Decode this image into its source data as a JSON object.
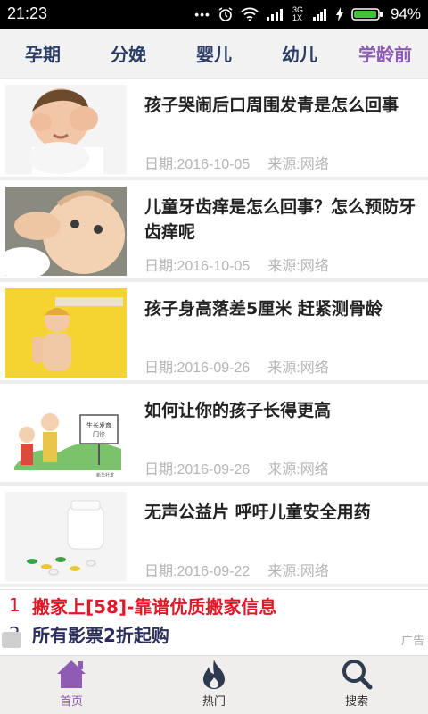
{
  "status": {
    "time": "21:23",
    "battery": "94%",
    "network": "3G 1X"
  },
  "tabs": [
    {
      "label": "孕期"
    },
    {
      "label": "分娩"
    },
    {
      "label": "婴儿"
    },
    {
      "label": "幼儿"
    },
    {
      "label": "学龄前"
    }
  ],
  "articles": [
    {
      "title": "孩子哭闹后口周围发青是怎么回事",
      "date": "日期:2016-10-05",
      "source": "来源:网络"
    },
    {
      "title": "儿童牙齿痒是怎么回事？怎么预防牙齿痒呢",
      "date": "日期:2016-10-05",
      "source": "来源:网络"
    },
    {
      "title": "孩子身高落差5厘米 赶紧测骨龄",
      "date": "日期:2016-09-26",
      "source": "来源:网络"
    },
    {
      "title": "如何让你的孩子长得更高",
      "date": "日期:2016-09-26",
      "source": "来源:网络"
    },
    {
      "title": "无声公益片 呼吁儿童安全用药",
      "date": "日期:2016-09-22",
      "source": "来源:网络"
    }
  ],
  "ad": {
    "items": [
      {
        "num": "1",
        "text": "搬家上[58]-靠谱优质搬家信息"
      },
      {
        "num": "2",
        "text": "所有影票2折起购"
      }
    ],
    "tag": "广告"
  },
  "bottom_nav": [
    {
      "label": "首页",
      "icon": "home-icon"
    },
    {
      "label": "热门",
      "icon": "fire-icon"
    },
    {
      "label": "搜索",
      "icon": "search-icon"
    }
  ],
  "thumb_text": {
    "sign_line1": "生长发育",
    "sign_line2": "门诊",
    "caption": "新华社发"
  },
  "colors": {
    "accent": "#8e5bb5",
    "tab_text": "#2c3e66",
    "ad_red": "#e0192a"
  }
}
